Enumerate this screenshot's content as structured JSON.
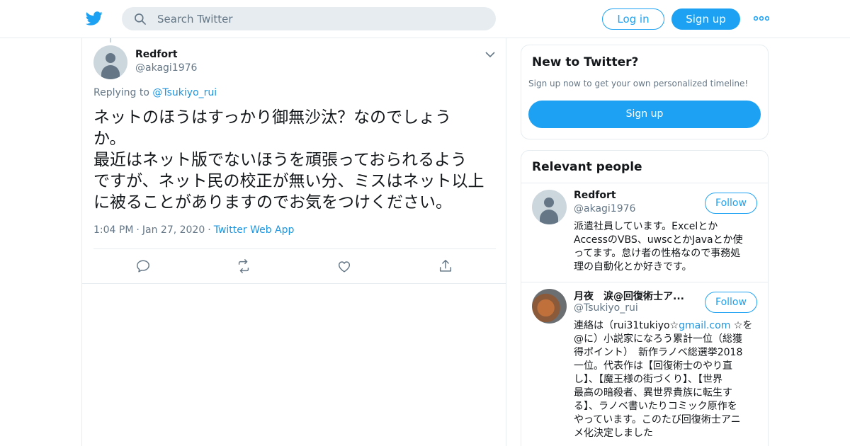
{
  "header": {
    "logo_icon": "twitter-bird-icon",
    "search_placeholder": "Search Twitter",
    "login_label": "Log in",
    "signup_label": "Sign up",
    "more_icon": "more-dots-icon",
    "accent": "#1da1f2"
  },
  "tweet": {
    "name": "Redfort",
    "handle": "@akagi1976",
    "replying_prefix": "Replying to",
    "replying_to": "@Tsukiyo_rui",
    "text": "ネットのほうはすっかり御無沙汰？なのでしょう\nか。\n最近はネット版でないほうを頑張っておられるよう\nですが、ネット民の校正が無い分、ミスはネット以上\nに被ることがありますのでお気をつけください。",
    "time": "1:04 PM",
    "date": "Jan 27, 2020",
    "source": "Twitter Web App",
    "actions": [
      "reply-icon",
      "retweet-icon",
      "like-icon",
      "share-icon"
    ]
  },
  "sidebar": {
    "new_card": {
      "title": "New to Twitter?",
      "subtitle": "Sign up now to get your own personalized timeline!",
      "button": "Sign up"
    },
    "relevant": {
      "title": "Relevant people",
      "people": [
        {
          "name": "Redfort",
          "handle": "@akagi1976",
          "follow": "Follow",
          "bio": "派遣社員しています。Excelとか\nAccessのVBS、uwscとかJavaとか使\nってます。怠け者の性格なので事務処\n理の自動化とか好きです。"
        },
        {
          "name": "月夜　涙@回復術士ア...",
          "handle": "@Tsukiyo_rui",
          "follow": "Follow",
          "bio_before_link": "連絡は（rui31tukiyo☆",
          "bio_link": "gmail.com",
          "bio_after_link": " ☆を\n@に）小説家になろう累計一位（総獲\n得ポイント）　新作ラノベ総選挙2018\n一位。代表作は【回復術士のやり直\nし】、【魔王様の街づくり】、【世界\n最高の暗殺者、異世界貴族に転生す\nる】、ラノベ書いたりコミック原作を\nやっています。このたび回復術士アニ\nメ化決定しました"
        }
      ]
    }
  }
}
